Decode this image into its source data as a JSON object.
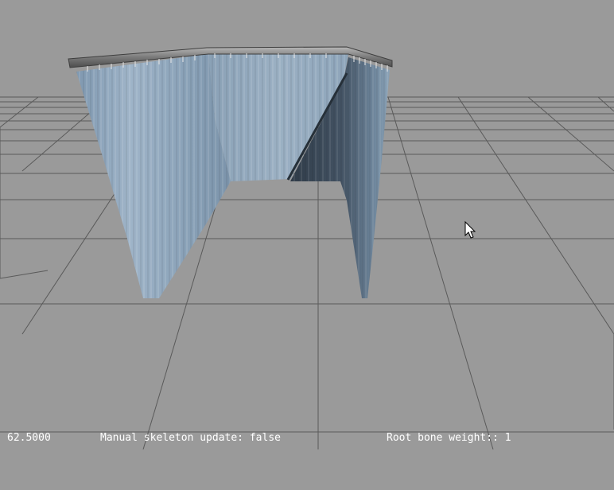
{
  "status": {
    "fps": "62.5000",
    "manual_skeleton_update": "Manual skeleton update: false",
    "root_bone_weight": "Root bone weight:: 1"
  },
  "colors": {
    "background": "#9a9a9a",
    "grid_line": "#5a5a5a",
    "cloth_light": "#8fa6bd",
    "cloth_dark": "#3b4857",
    "rail": "#6e6e6e",
    "status_text": "#ffffff"
  },
  "icons": {
    "cursor": "mouse-pointer-icon"
  }
}
